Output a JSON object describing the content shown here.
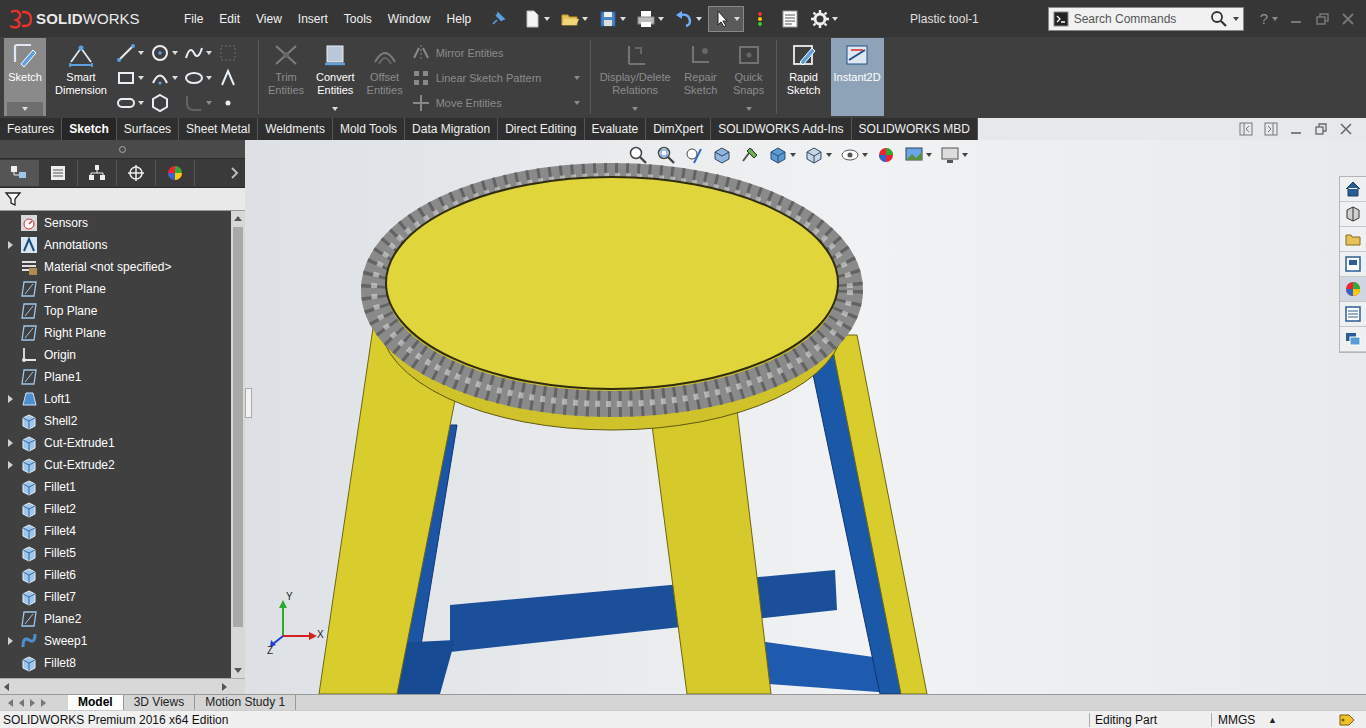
{
  "app": {
    "logo": {
      "bold": "SOLID",
      "light": "WORKS"
    },
    "title": "Plastic tool-1"
  },
  "menu": [
    "File",
    "Edit",
    "View",
    "Insert",
    "Tools",
    "Window",
    "Help"
  ],
  "search": {
    "placeholder": "Search Commands"
  },
  "help": {
    "label": "?"
  },
  "ribbon": {
    "primary": [
      {
        "label": "Sketch",
        "selected": true,
        "disabled": false,
        "dropdown": true
      },
      {
        "label": "Smart Dimension",
        "selected": false,
        "disabled": false,
        "dropdown": false
      }
    ],
    "edit": [
      {
        "label": "Trim Entities",
        "selected": false,
        "disabled": true,
        "dropdown": false
      },
      {
        "label": "Convert Entities",
        "selected": false,
        "disabled": false,
        "dropdown": true
      },
      {
        "label": "Offset Entities",
        "selected": false,
        "disabled": true,
        "dropdown": false
      }
    ],
    "list": [
      {
        "label": "Mirror Entities",
        "disabled": true,
        "dropdown": false
      },
      {
        "label": "Linear Sketch Pattern",
        "disabled": true,
        "dropdown": true
      },
      {
        "label": "Move Entities",
        "disabled": true,
        "dropdown": true
      }
    ],
    "relations": [
      {
        "label": "Display/Delete Relations",
        "selected": false,
        "disabled": true,
        "dropdown": true
      },
      {
        "label": "Repair Sketch",
        "selected": false,
        "disabled": true,
        "dropdown": false
      },
      {
        "label": "Quick Snaps",
        "selected": false,
        "disabled": true,
        "dropdown": true
      }
    ],
    "modes": [
      {
        "label": "Rapid Sketch",
        "selected": false,
        "disabled": false,
        "dropdown": false
      },
      {
        "label": "Instant2D",
        "selected": true,
        "disabled": false,
        "dropdown": false
      }
    ]
  },
  "command_tabs": [
    {
      "label": "Features",
      "selected": false
    },
    {
      "label": "Sketch",
      "selected": true
    },
    {
      "label": "Surfaces",
      "selected": false
    },
    {
      "label": "Sheet Metal",
      "selected": false
    },
    {
      "label": "Weldments",
      "selected": false
    },
    {
      "label": "Mold Tools",
      "selected": false
    },
    {
      "label": "Data Migration",
      "selected": false
    },
    {
      "label": "Direct Editing",
      "selected": false
    },
    {
      "label": "Evaluate",
      "selected": false
    },
    {
      "label": "DimXpert",
      "selected": false
    },
    {
      "label": "SOLIDWORKS Add-Ins",
      "selected": false
    },
    {
      "label": "SOLIDWORKS MBD",
      "selected": false
    }
  ],
  "feature_tree": [
    {
      "label": "Sensors",
      "kind": "sensor",
      "expandable": false
    },
    {
      "label": "Annotations",
      "kind": "annotation",
      "expandable": true
    },
    {
      "label": "Material <not specified>",
      "kind": "material",
      "expandable": false
    },
    {
      "label": "Front Plane",
      "kind": "plane",
      "expandable": false
    },
    {
      "label": "Top Plane",
      "kind": "plane",
      "expandable": false
    },
    {
      "label": "Right Plane",
      "kind": "plane",
      "expandable": false
    },
    {
      "label": "Origin",
      "kind": "origin",
      "expandable": false
    },
    {
      "label": "Plane1",
      "kind": "plane",
      "expandable": false
    },
    {
      "label": "Loft1",
      "kind": "loft",
      "expandable": true
    },
    {
      "label": "Shell2",
      "kind": "feature",
      "expandable": false
    },
    {
      "label": "Cut-Extrude1",
      "kind": "feature",
      "expandable": true
    },
    {
      "label": "Cut-Extrude2",
      "kind": "feature",
      "expandable": true
    },
    {
      "label": "Fillet1",
      "kind": "feature",
      "expandable": false
    },
    {
      "label": "Fillet2",
      "kind": "feature",
      "expandable": false
    },
    {
      "label": "Fillet4",
      "kind": "feature",
      "expandable": false
    },
    {
      "label": "Fillet5",
      "kind": "feature",
      "expandable": false
    },
    {
      "label": "Fillet6",
      "kind": "feature",
      "expandable": false
    },
    {
      "label": "Fillet7",
      "kind": "feature",
      "expandable": false
    },
    {
      "label": "Plane2",
      "kind": "plane",
      "expandable": false
    },
    {
      "label": "Sweep1",
      "kind": "sweep",
      "expandable": true
    },
    {
      "label": "Fillet8",
      "kind": "feature",
      "expandable": false
    }
  ],
  "model_tabs": [
    {
      "label": "Model",
      "selected": true
    },
    {
      "label": "3D Views",
      "selected": false
    },
    {
      "label": "Motion Study 1",
      "selected": false
    }
  ],
  "triad": {
    "y": "Y",
    "x": "X",
    "z": "Z"
  },
  "status_bar": {
    "product": "SOLIDWORKS Premium 2016 x64 Edition",
    "mode": "Editing Part",
    "units": "MMGS",
    "units_arrow": "▲"
  }
}
